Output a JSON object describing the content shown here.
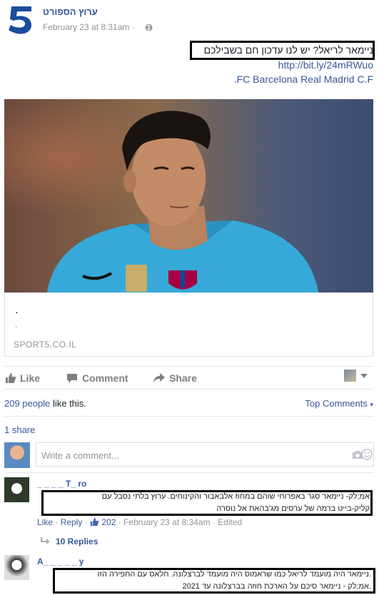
{
  "post": {
    "page_name": "ערוץ הספורט",
    "time": "February 23 at 8:31am",
    "text_line1": "ניימאר לריאל? יש לנו עדכון חם בשבילכם",
    "link_url": "http://bit.ly/24mRWuo",
    "hashtags": ".FC Barcelona Real Madrid C.F"
  },
  "link_card": {
    "dot1": ".",
    "dot2": ".",
    "source": "SPORT5.CO.IL"
  },
  "actions": {
    "like": "Like",
    "comment": "Comment",
    "share": "Share"
  },
  "stats": {
    "likes_count": "209 people",
    "likes_suffix": " like this.",
    "top_comments": "Top Comments",
    "shares": "1 share"
  },
  "comment_input": {
    "placeholder": "Write a comment..."
  },
  "comments": [
    {
      "author": "_ _ _ _ T_ ro",
      "line1": "אמ;לק- ניימאר סגר באפרוחי שוהם במחוז אלבאבור והקינוחים. ערוץ בלתי נסבל עם",
      "line2": "קליק-בייט ברמה של ערסים מג'בהאת אל נוסרה",
      "like": "Like",
      "reply": "Reply",
      "likes": "202",
      "time": "February 23 at 8:34am",
      "edited": "Edited",
      "replies": "10 Replies"
    },
    {
      "author": "A_ _ _ _ _ y",
      "line1": "ניימאר היה מועמד לריאל כמו שראמוס היה מועמד לברצלונה. חלאס עם החפירה הזו.",
      "line2": "אמ;לק - ניימאר סיכם על הארכת חוזה בברצלונה עד 2021."
    }
  ],
  "colors": {
    "link": "#365899",
    "meta": "#90949c",
    "logo_blue": "#1a4c9c"
  }
}
